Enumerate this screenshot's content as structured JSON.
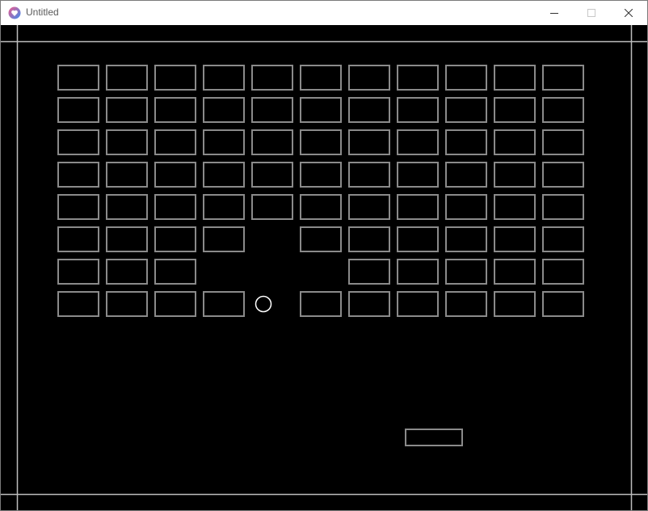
{
  "window": {
    "title": "Untitled",
    "icon": "app-heart-icon",
    "controls": [
      "minimize-icon",
      "maximize-icon",
      "close-icon"
    ]
  },
  "game": {
    "colors": {
      "background": "#000000",
      "outline": "#8a8a8a",
      "wall": "#bdbdbd",
      "ball": "#ffffff"
    },
    "brick_columns": 11,
    "brick_rows": 8,
    "bricks": [
      [
        1,
        1,
        1,
        1,
        1,
        1,
        1,
        1,
        1,
        1,
        1
      ],
      [
        1,
        1,
        1,
        1,
        1,
        1,
        1,
        1,
        1,
        1,
        1
      ],
      [
        1,
        1,
        1,
        1,
        1,
        1,
        1,
        1,
        1,
        1,
        1
      ],
      [
        1,
        1,
        1,
        1,
        1,
        1,
        1,
        1,
        1,
        1,
        1
      ],
      [
        1,
        1,
        1,
        1,
        1,
        1,
        1,
        1,
        1,
        1,
        1
      ],
      [
        1,
        1,
        1,
        1,
        0,
        1,
        1,
        1,
        1,
        1,
        1
      ],
      [
        1,
        1,
        1,
        0,
        0,
        0,
        1,
        1,
        1,
        1,
        1
      ],
      [
        1,
        1,
        1,
        1,
        0,
        1,
        1,
        1,
        1,
        1,
        1
      ]
    ]
  }
}
